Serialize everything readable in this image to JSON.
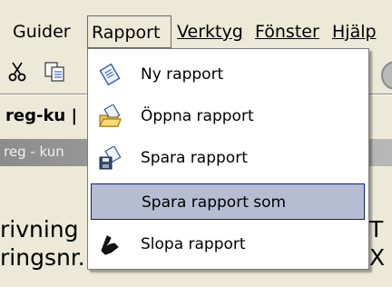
{
  "menubar": {
    "items": [
      {
        "label": "Guider"
      },
      {
        "label": "Rapport"
      },
      {
        "label": "Verktyg"
      },
      {
        "label": "Fönster"
      },
      {
        "label": "Hjälp"
      }
    ]
  },
  "toolbar": {
    "icons": [
      "scissors-icon",
      "copy-icon",
      "circle-icon"
    ]
  },
  "tab": {
    "label": "reg-ku |"
  },
  "window": {
    "title": "reg - kun"
  },
  "form": {
    "left_lines": [
      "rivning",
      "ringsnr."
    ],
    "right_lines": [
      "T",
      "X"
    ]
  },
  "dropdown": {
    "items": [
      {
        "label": "Ny rapport",
        "icon": "new-report-icon"
      },
      {
        "label": "Öppna rapport",
        "icon": "open-report-icon"
      },
      {
        "label": "Spara rapport",
        "icon": "save-report-icon"
      },
      {
        "label": "Spara rapport som",
        "icon": "none",
        "selected": true
      },
      {
        "label": "Slopa rapport",
        "icon": "delete-report-icon"
      }
    ]
  },
  "colors": {
    "menu_bg": "#ece9d8",
    "selection_bg": "#b6bdd2",
    "selection_border": "#0a246a",
    "titlebar": "#9a9a9a"
  }
}
